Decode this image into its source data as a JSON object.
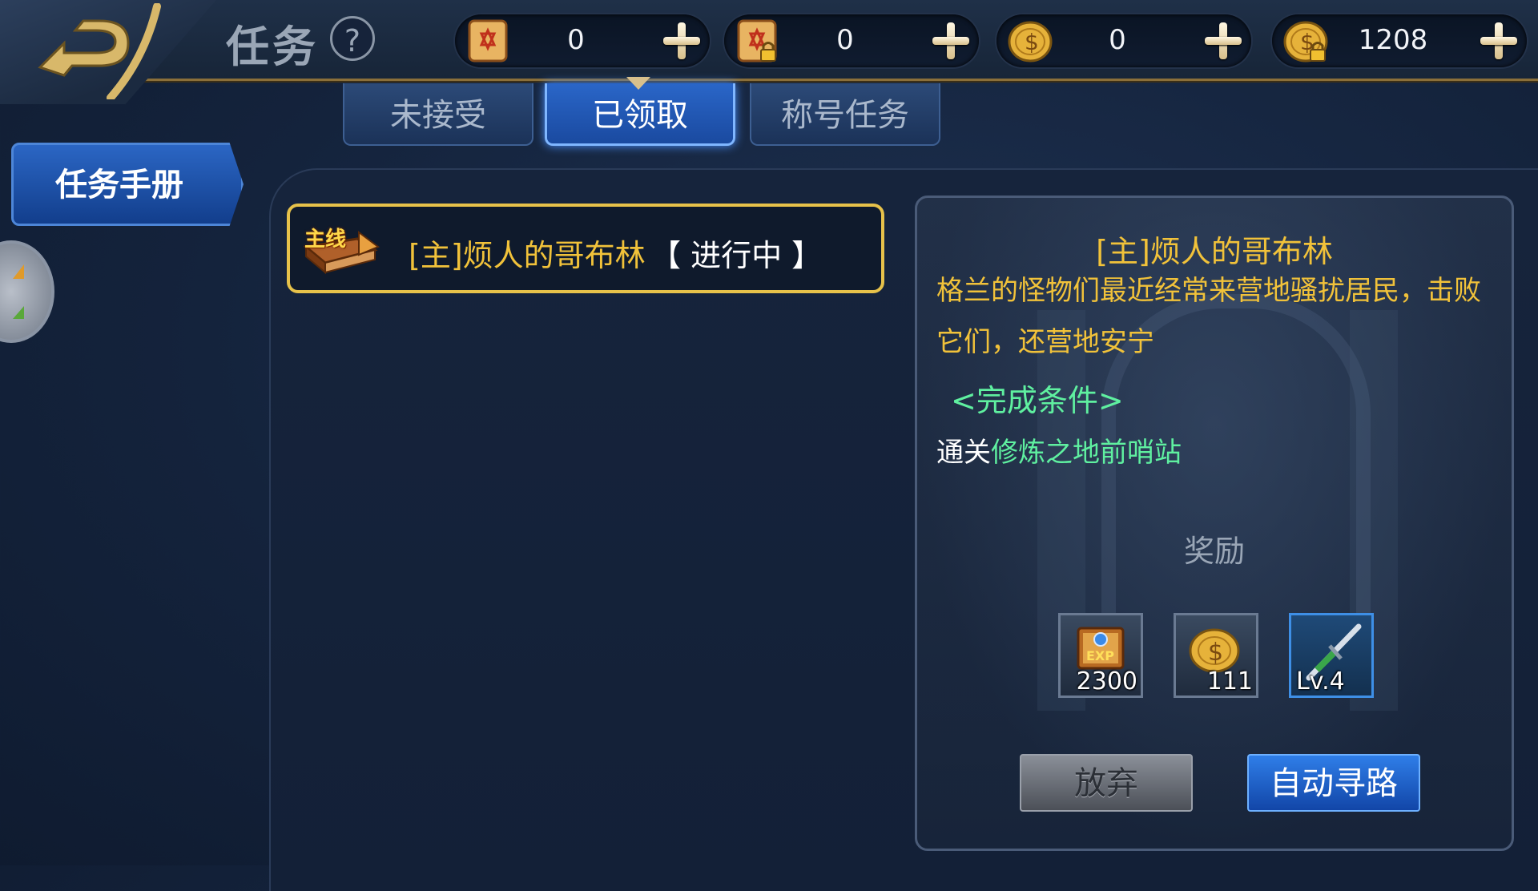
{
  "header": {
    "title": "任务",
    "help_label": "?",
    "currencies": [
      {
        "icon": "scroll-icon",
        "value": "0"
      },
      {
        "icon": "locked-scroll-icon",
        "value": "0"
      },
      {
        "icon": "gold-coin-icon",
        "value": "0"
      },
      {
        "icon": "locked-gold-coin-icon",
        "value": "1208"
      }
    ]
  },
  "tabs": [
    {
      "label": "未接受",
      "active": false
    },
    {
      "label": "已领取",
      "active": true
    },
    {
      "label": "称号任务",
      "active": false
    }
  ],
  "sidebar": {
    "items": [
      {
        "label": "任务手册",
        "active": true
      }
    ]
  },
  "quest_list": [
    {
      "badge": "主线",
      "name": "[主]烦人的哥布林",
      "status": "【 进行中 】"
    }
  ],
  "detail": {
    "title": "[主]烦人的哥布林",
    "description": "格兰的怪物们最近经常来营地骚扰居民，击败它们，还营地安宁",
    "condition_label": "<完成条件>",
    "target_prefix": "通关",
    "target_location": "修炼之地前哨站",
    "reward_label": "奖励",
    "rewards": [
      {
        "icon": "exp-book-icon",
        "amount": "2300"
      },
      {
        "icon": "gold-coin-icon",
        "amount": "111"
      },
      {
        "icon": "sword-icon",
        "amount": "Lv.4"
      }
    ],
    "abandon_label": "放弃",
    "auto_path_label": "自动寻路"
  },
  "colors": {
    "gold_text": "#f1c23a",
    "green_text": "#5ff0a0",
    "tab_active": "#2a66c8",
    "quest_border": "#e7c24a"
  }
}
